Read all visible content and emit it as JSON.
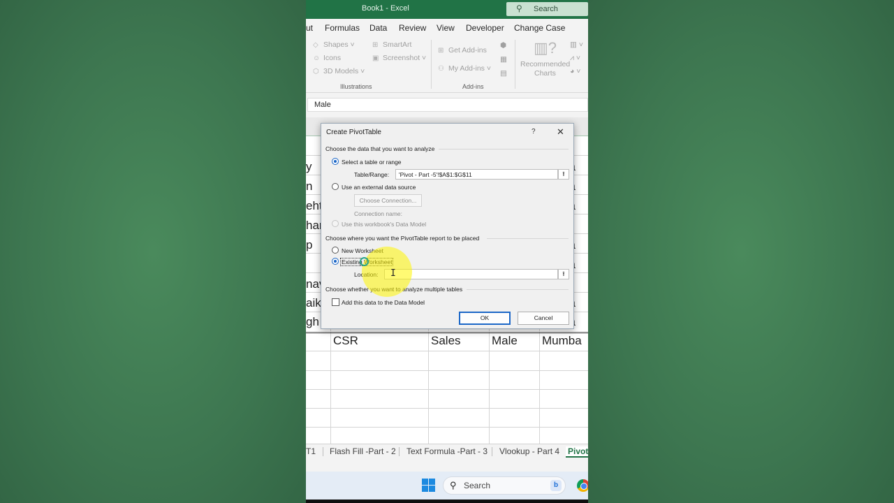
{
  "window": {
    "title": "Book1  -  Excel"
  },
  "search": {
    "label": "Search"
  },
  "ribbon_tabs": [
    "ut",
    "Formulas",
    "Data",
    "Review",
    "View",
    "Developer",
    "Change Case"
  ],
  "ribbon": {
    "illustrations": {
      "shapes": "Shapes",
      "icons": "Icons",
      "models": "3D Models",
      "smartart": "SmartArt",
      "screenshot": "Screenshot",
      "group_label": "Illustrations"
    },
    "addins": {
      "get": "Get Add-ins",
      "my": "My Add-ins",
      "group_label": "Add-ins"
    },
    "recommended": {
      "line1": "Recommended",
      "line2": "Charts"
    }
  },
  "formula_bar": {
    "value": "Male"
  },
  "grid": {
    "left_fragments": [
      "y",
      "n",
      "eht",
      "har",
      "p",
      "",
      "nav",
      "aik",
      "gh"
    ],
    "right_fragments": [
      "ba",
      "ba",
      "ba",
      "",
      "ba",
      "ba",
      "",
      "ba",
      "ba"
    ],
    "bottom_row": {
      "a": "CSR",
      "b": "Sales",
      "c": "Male",
      "d": "Mumba"
    }
  },
  "sheet_tabs": [
    "T1",
    "Flash Fill -Part - 2",
    "Text Formula -Part - 3",
    "Vlookup - Part 4",
    "Pivot"
  ],
  "taskbar": {
    "search_label": "Search"
  },
  "dialog": {
    "title": "Create PivotTable",
    "help": "?",
    "close": "✕",
    "section1": "Choose the data that you want to analyze",
    "opt_table": "Select a table or range",
    "table_range_label": "Table/Range:",
    "table_range_value": "'Pivot - Part -5'!$A$1:$G$11",
    "opt_external": "Use an external data source",
    "choose_connection": "Choose Connection...",
    "connection_name": "Connection name:",
    "opt_datamodel": "Use this workbook's Data Model",
    "section2": "Choose where you want the PivotTable report to be placed",
    "opt_new": "New Worksheet",
    "opt_existing": "Existing Worksheet",
    "location_label": "Location:",
    "section3": "Choose whether you want to analyze multiple tables",
    "add_datamodel": "Add this data to the Data Model",
    "ok": "OK",
    "cancel": "Cancel"
  },
  "colors": {
    "excel_green": "#217346",
    "accent_blue": "#1a66c7",
    "highlight_yellow": "#fff500"
  }
}
